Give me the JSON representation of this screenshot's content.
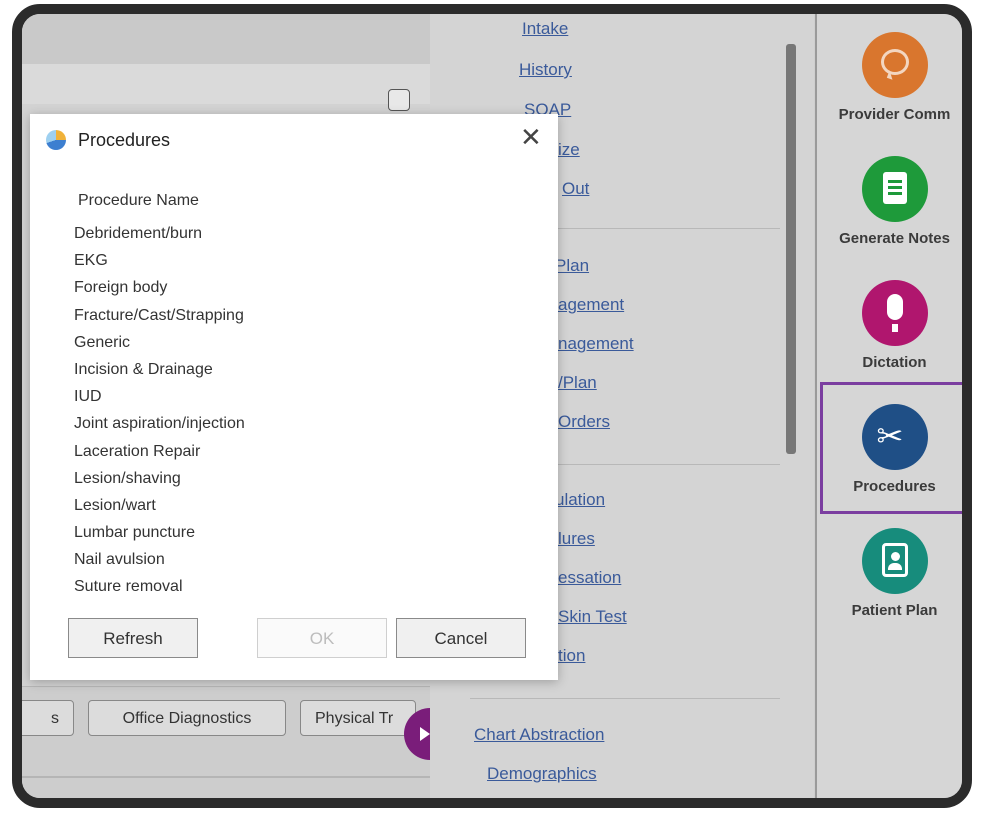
{
  "background": {
    "bottom_tabs": [
      "s",
      "Office Diagnostics",
      "Physical Tr"
    ]
  },
  "middle_links": {
    "group1": [
      "Intake",
      "History",
      "SOAP",
      "ize",
      "Out"
    ],
    "group2": [
      "Plan",
      "agement",
      "nagement",
      "/Plan",
      "Orders"
    ],
    "group3": [
      "ulation",
      "lures",
      "essation",
      "Skin Test",
      "tion"
    ],
    "group4": [
      "Chart Abstraction",
      "Demographics"
    ]
  },
  "quick_access": [
    {
      "label": "Provider Comm",
      "icon": "chat-bubble-icon",
      "color": "#d9762e"
    },
    {
      "label": "Generate Notes",
      "icon": "notepad-icon",
      "color": "#1e9a3a"
    },
    {
      "label": "Dictation",
      "icon": "microphone-icon",
      "color": "#b0166e"
    },
    {
      "label": "Procedures",
      "icon": "scissors-icon",
      "color": "#1f4f86",
      "selected": true
    },
    {
      "label": "Patient Plan",
      "icon": "id-badge-icon",
      "color": "#178c7c"
    }
  ],
  "dialog": {
    "title": "Procedures",
    "column_header": "Procedure Name",
    "procedures": [
      "Debridement/burn",
      "EKG",
      "Foreign body",
      "Fracture/Cast/Strapping",
      "Generic",
      "Incision & Drainage",
      "IUD",
      "Joint aspiration/injection",
      "Laceration Repair",
      "Lesion/shaving",
      "Lesion/wart",
      "Lumbar puncture",
      "Nail avulsion",
      "Suture removal"
    ],
    "buttons": {
      "refresh": "Refresh",
      "ok": "OK",
      "cancel": "Cancel"
    }
  }
}
